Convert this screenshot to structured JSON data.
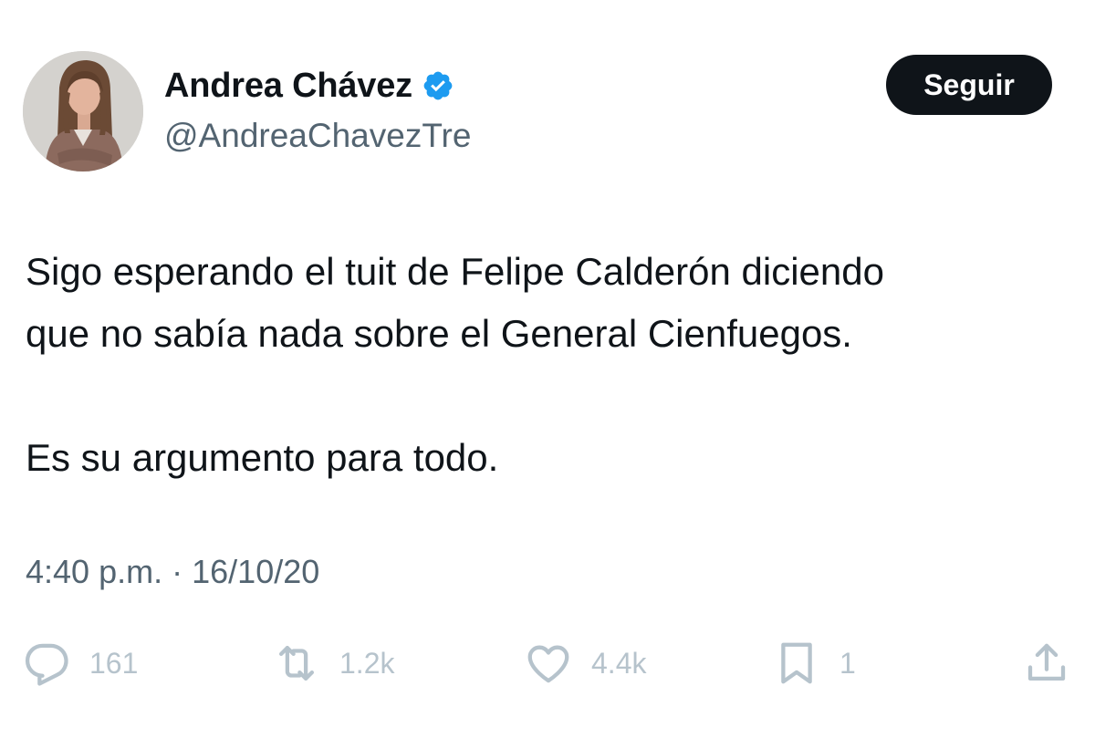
{
  "author": {
    "display_name": "Andrea Chávez",
    "handle": "@AndreaChavezTre",
    "verified": true
  },
  "follow_button": {
    "label": "Seguir"
  },
  "tweet": {
    "paragraphs": [
      "Sigo esperando el tuit de Felipe Calderón diciendo",
      "que no sabía nada sobre el General Cienfuegos.",
      "Es su argumento para todo."
    ],
    "time": "4:40 p.m.",
    "separator": "·",
    "date": "16/10/20"
  },
  "actions": {
    "reply": {
      "icon": "reply-icon",
      "count": "161"
    },
    "retweet": {
      "icon": "retweet-icon",
      "count": "1.2k"
    },
    "like": {
      "icon": "heart-icon",
      "count": "4.4k"
    },
    "bookmark": {
      "icon": "bookmark-icon",
      "count": "1"
    },
    "share": {
      "icon": "share-icon"
    }
  },
  "colors": {
    "text": "#0f1419",
    "secondary_text": "#536471",
    "verified_blue": "#1d9bf0",
    "action_icons": "#b6c3cc",
    "button_bg": "#0f1419"
  }
}
